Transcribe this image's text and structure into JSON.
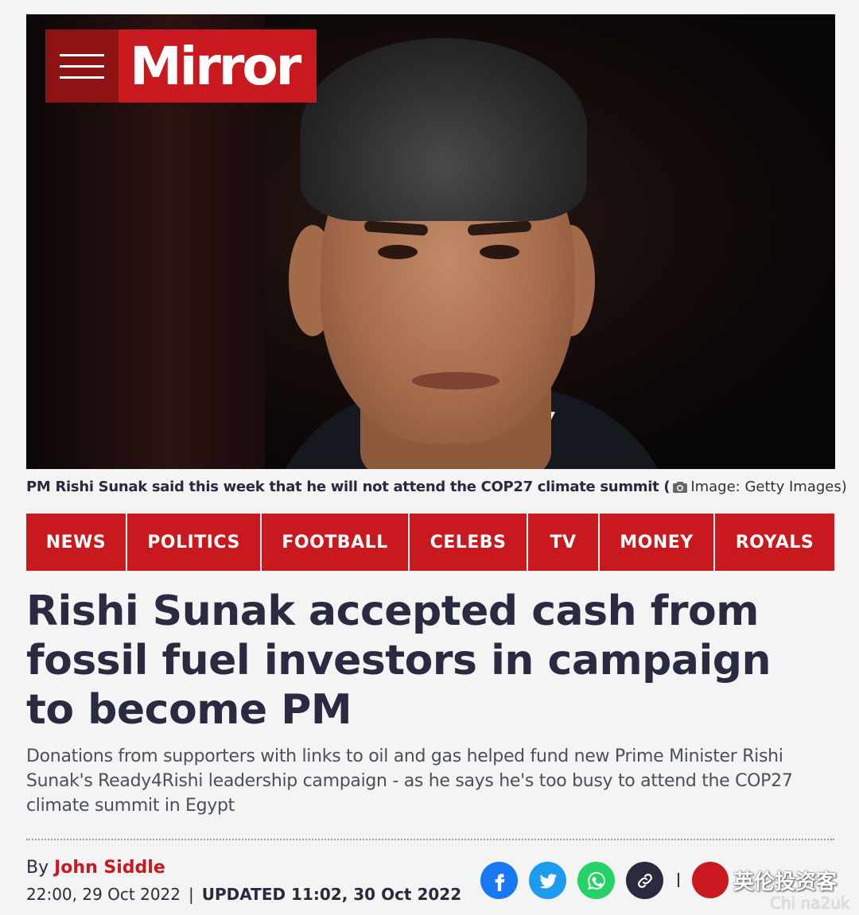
{
  "header": {
    "brand": "Mirror"
  },
  "hero": {
    "caption": "PM Rishi Sunak said this week that he will not attend the COP27 climate summit (",
    "credit": "Image: Getty Images)"
  },
  "nav": {
    "items": [
      {
        "label": "NEWS",
        "width": 125
      },
      {
        "label": "POLITICS",
        "width": 167
      },
      {
        "label": "FOOTBALL",
        "width": 184
      },
      {
        "label": "CELEBS",
        "width": 147
      },
      {
        "label": "TV",
        "width": 88
      },
      {
        "label": "MONEY",
        "width": 143
      },
      {
        "label": "ROYALS",
        "width": 150
      }
    ]
  },
  "article": {
    "headline": "Rishi Sunak accepted cash from fossil fuel investors in campaign to become PM",
    "standfirst": "Donations from supporters with links to oil and gas helped fund new Prime Minister Rishi Sunak's Ready4Rishi leadership campaign - as he says he's too busy to attend the COP27 climate summit in Egypt",
    "by": "By",
    "author": "John Siddle",
    "published": "22:00, 29 Oct 2022",
    "separator": "|",
    "updated": "UPDATED 11:02, 30 Oct 2022"
  },
  "share": {
    "icons": [
      "facebook-icon",
      "twitter-icon",
      "whatsapp-icon",
      "link-icon"
    ]
  },
  "watermark": {
    "text": "英伦投资客",
    "site": "Chi na2uk"
  },
  "colors": {
    "brand_red": "#c8191e",
    "dark_red": "#8e1414",
    "text_dark": "#2a2a40"
  }
}
